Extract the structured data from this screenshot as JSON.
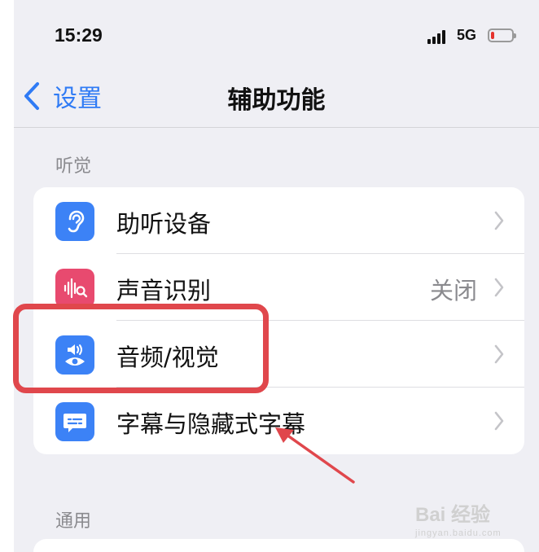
{
  "status_bar": {
    "time": "15:29",
    "network": "5G",
    "battery_level": 0.1
  },
  "nav": {
    "back_label": "设置",
    "title": "辅助功能"
  },
  "sections": [
    {
      "header": "听觉",
      "items": [
        {
          "label": "助听设备",
          "value": "",
          "icon": "ear-icon",
          "color": "#3c82f6"
        },
        {
          "label": "声音识别",
          "value": "关闭",
          "icon": "sound-recognition-icon",
          "color": "#e84a6f"
        },
        {
          "label": "音频/视觉",
          "value": "",
          "icon": "audio-visual-icon",
          "color": "#3c82f6"
        },
        {
          "label": "字幕与隐藏式字幕",
          "value": "",
          "icon": "subtitles-icon",
          "color": "#3c82f6"
        }
      ]
    },
    {
      "header": "通用",
      "items": []
    }
  ],
  "annotation": {
    "highlight_color": "#e0474c"
  },
  "watermark": {
    "main": "Bai 经验",
    "sub": "jingyan.baidu.com"
  }
}
